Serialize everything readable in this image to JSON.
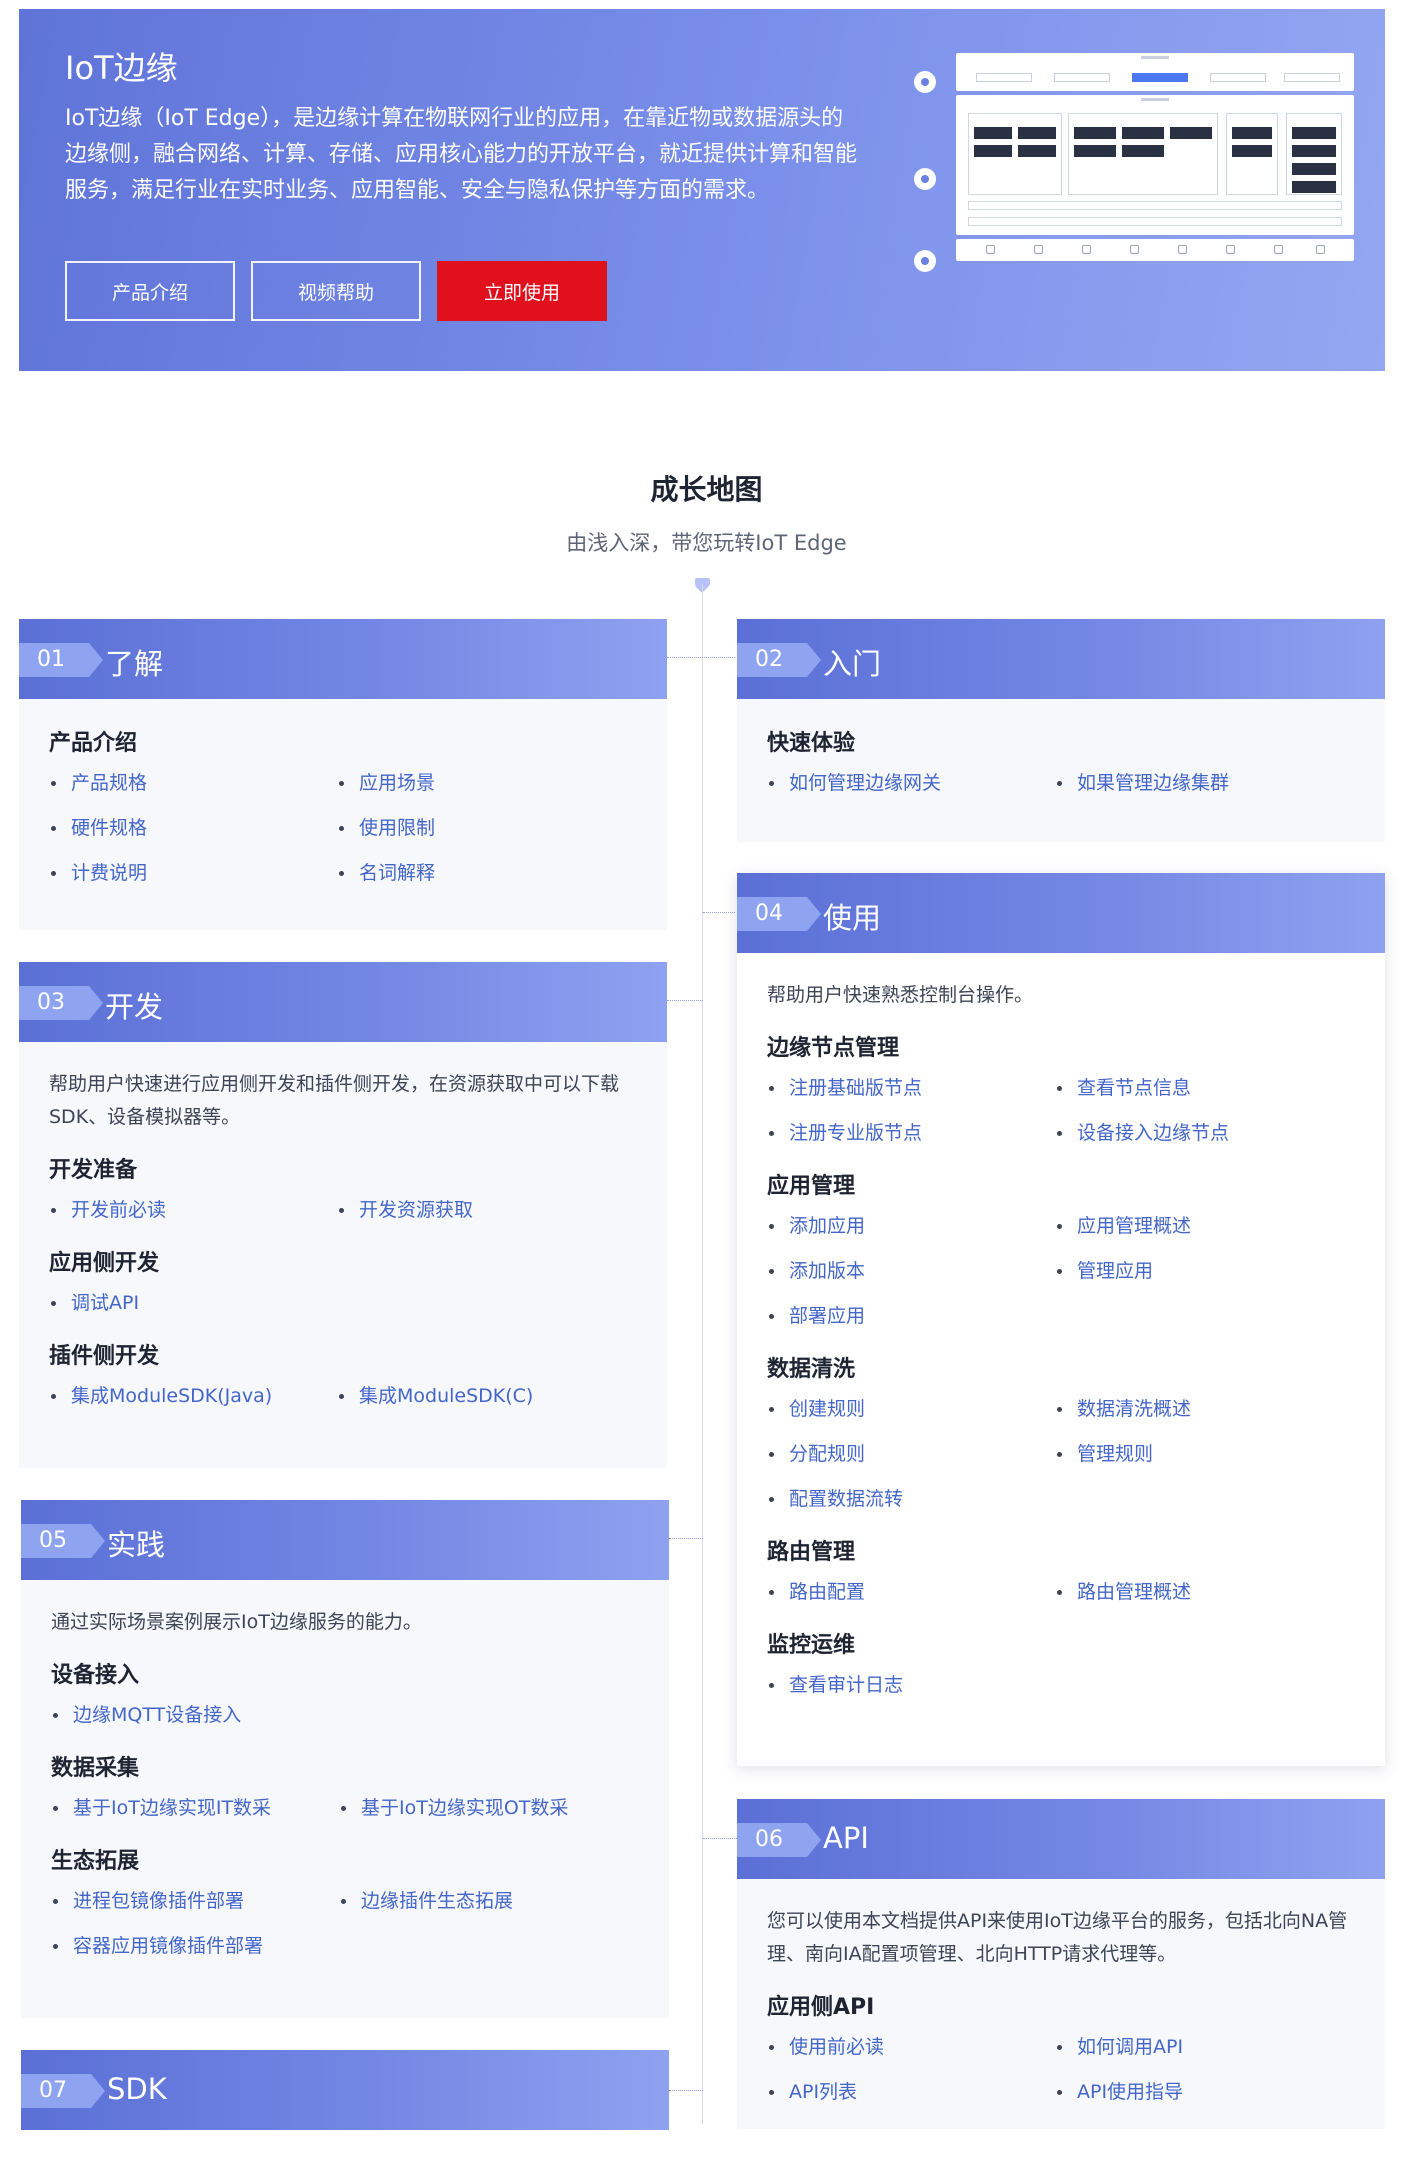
{
  "hero": {
    "title": "IoT边缘",
    "description": "IoT边缘（IoT Edge），是边缘计算在物联网行业的应用，在靠近物或数据源头的边缘侧，融合网络、计算、存储、应用核心能力的开放平台，就近提供计算和智能服务，满足行业在实时业务、应用智能、安全与隐私保护等方面的需求。",
    "buttons": {
      "intro": "产品介绍",
      "video": "视频帮助",
      "use": "立即使用"
    },
    "accent_color": "#e0101d"
  },
  "growth": {
    "title": "成长地图",
    "subtitle": "由浅入深，带您玩转IoT Edge"
  },
  "cards": {
    "c01": {
      "num": "01",
      "title": "了解",
      "groups": [
        {
          "title": "产品介绍",
          "links": [
            "产品规格",
            "应用场景",
            "硬件规格",
            "使用限制",
            "计费说明",
            "名词解释"
          ]
        }
      ]
    },
    "c02": {
      "num": "02",
      "title": "入门",
      "groups": [
        {
          "title": "快速体验",
          "links": [
            "如何管理边缘网关",
            "如果管理边缘集群"
          ]
        }
      ]
    },
    "c03": {
      "num": "03",
      "title": "开发",
      "desc": "帮助用户快速进行应用侧开发和插件侧开发，在资源获取中可以下载SDK、设备模拟器等。",
      "groups": [
        {
          "title": "开发准备",
          "links": [
            "开发前必读",
            "开发资源获取"
          ]
        },
        {
          "title": "应用侧开发",
          "links": [
            "调试API"
          ]
        },
        {
          "title": "插件侧开发",
          "links": [
            "集成ModuleSDK(Java)",
            "集成ModuleSDK(C)"
          ]
        }
      ]
    },
    "c04": {
      "num": "04",
      "title": "使用",
      "desc": "帮助用户快速熟悉控制台操作。",
      "groups": [
        {
          "title": "边缘节点管理",
          "links": [
            "注册基础版节点",
            "查看节点信息",
            "注册专业版节点",
            "设备接入边缘节点"
          ]
        },
        {
          "title": "应用管理",
          "links": [
            "添加应用",
            "应用管理概述",
            "添加版本",
            "管理应用",
            "部署应用"
          ]
        },
        {
          "title": "数据清洗",
          "links": [
            "创建规则",
            "数据清洗概述",
            "分配规则",
            "管理规则",
            "配置数据流转"
          ]
        },
        {
          "title": "路由管理",
          "links": [
            "路由配置",
            "路由管理概述"
          ]
        },
        {
          "title": "监控运维",
          "links": [
            "查看审计日志"
          ]
        }
      ]
    },
    "c05": {
      "num": "05",
      "title": "实践",
      "desc": "通过实际场景案例展示IoT边缘服务的能力。",
      "groups": [
        {
          "title": "设备接入",
          "links": [
            "边缘MQTT设备接入"
          ]
        },
        {
          "title": "数据采集",
          "links": [
            "基于IoT边缘实现IT数采",
            "基于IoT边缘实现OT数采"
          ]
        },
        {
          "title": "生态拓展",
          "links": [
            "进程包镜像插件部署",
            "边缘插件生态拓展",
            "容器应用镜像插件部署"
          ]
        }
      ]
    },
    "c06": {
      "num": "06",
      "title": "API",
      "desc": "您可以使用本文档提供API来使用IoT边缘平台的服务，包括北向NA管理、南向IA配置项管理、北向HTTP请求代理等。",
      "groups": [
        {
          "title": "应用侧API",
          "links": [
            "使用前必读",
            "如何调用API",
            "API列表",
            "API使用指导"
          ]
        }
      ]
    },
    "c07": {
      "num": "07",
      "title": "SDK"
    }
  }
}
